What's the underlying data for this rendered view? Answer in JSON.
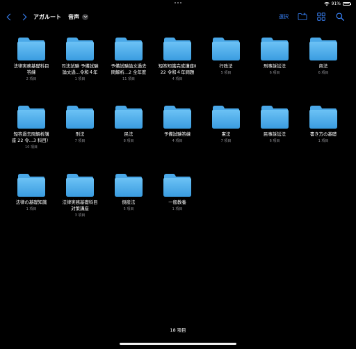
{
  "status": {
    "battery_percent": "91%",
    "battery_level": 0.91
  },
  "nav": {
    "parent": "アガルート",
    "title": "音声",
    "select_label": "選択"
  },
  "colors": {
    "accent": "#3a86ff",
    "folder_top": "#6cc2f5",
    "folder_bottom": "#3a9ce0",
    "folder_tab": "#4aa8e8",
    "secondary_text": "#8e8e93"
  },
  "items": [
    {
      "name": "法律実務基礎科目\n答練",
      "count": "2 項目"
    },
    {
      "name": "司法試験 予備試験\n論文過...令和４年",
      "count": "1 項目"
    },
    {
      "name": "予備試験論文過去\n問解析...2 全年度",
      "count": "11 項目"
    },
    {
      "name": "短答知識完成講座Ⅱ\n22 令和４年問題",
      "count": "4 項目"
    },
    {
      "name": "行政法",
      "count": "5 項目"
    },
    {
      "name": "刑事訴訟法",
      "count": "6 項目"
    },
    {
      "name": "商法",
      "count": "6 項目"
    },
    {
      "name": "短答過去問解析講\n座 22 令...3 科目）",
      "count": "10 項目"
    },
    {
      "name": "刑法",
      "count": "7 項目"
    },
    {
      "name": "民法",
      "count": "8 項目"
    },
    {
      "name": "予備試験答練",
      "count": "4 項目"
    },
    {
      "name": "憲法",
      "count": "7 項目"
    },
    {
      "name": "民事訴訟法",
      "count": "6 項目"
    },
    {
      "name": "書き方の基礎",
      "count": "1 項目"
    },
    {
      "name": "法律の基礎知識",
      "count": "1 項目"
    },
    {
      "name": "法律実務基礎科目\n対策講座",
      "count": "3 項目"
    },
    {
      "name": "倒産法",
      "count": "5 項目"
    },
    {
      "name": "一般教養",
      "count": "1 項目"
    }
  ],
  "footer": {
    "total": "18 項目"
  }
}
